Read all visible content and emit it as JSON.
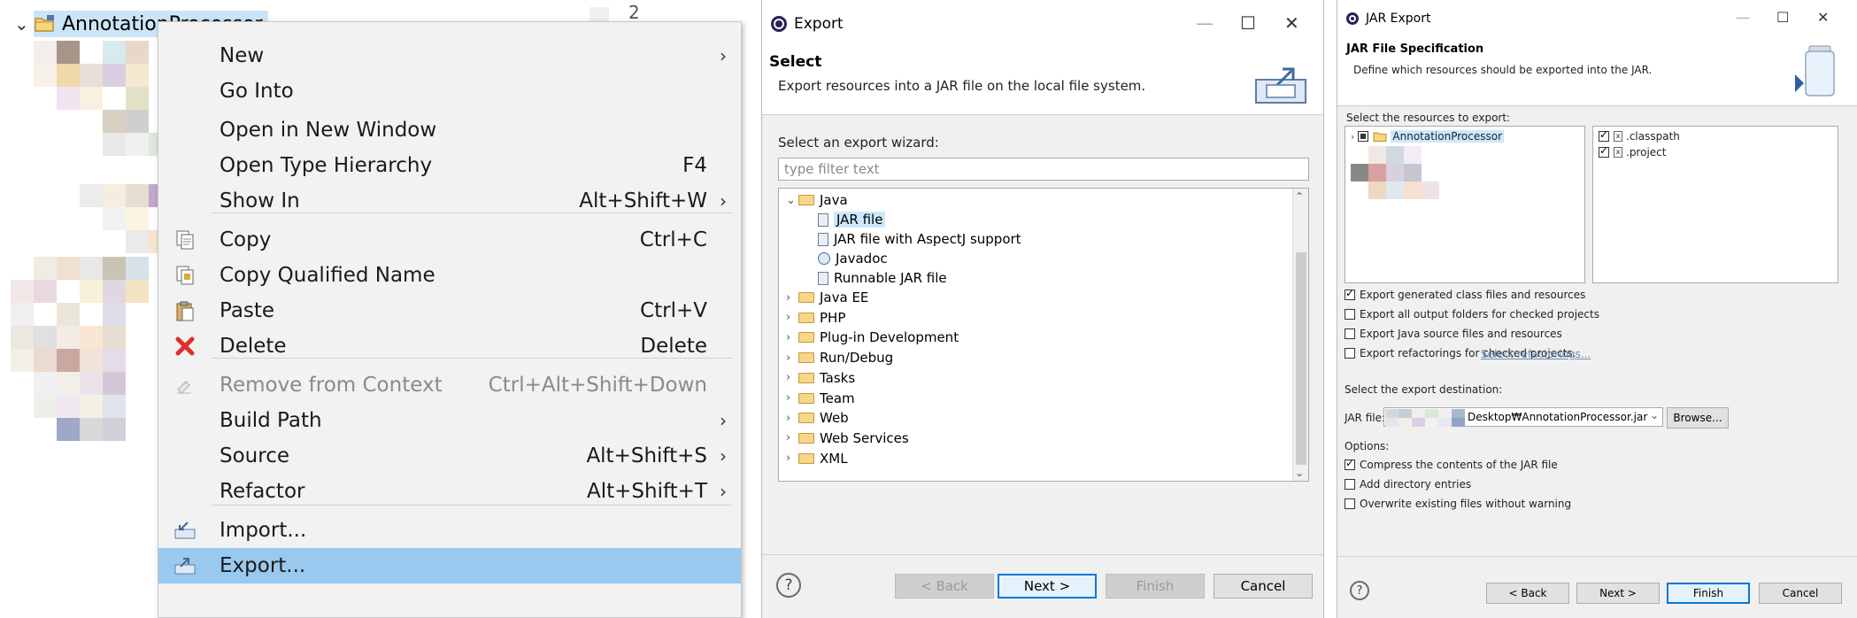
{
  "explorer": {
    "project_name": "AnnotationProcessor",
    "line_number": "2"
  },
  "context_menu": {
    "items": [
      {
        "label": "New",
        "shortcut": "",
        "submenu": true,
        "icon": ""
      },
      {
        "label": "Go Into",
        "shortcut": "",
        "submenu": false,
        "icon": ""
      },
      {
        "label": "Open in New Window",
        "shortcut": "",
        "submenu": false,
        "icon": ""
      },
      {
        "label": "Open Type Hierarchy",
        "shortcut": "F4",
        "submenu": false,
        "icon": ""
      },
      {
        "label": "Show In",
        "shortcut": "Alt+Shift+W",
        "submenu": true,
        "icon": ""
      },
      {
        "label": "Copy",
        "shortcut": "Ctrl+C",
        "submenu": false,
        "icon": "copy-icon"
      },
      {
        "label": "Copy Qualified Name",
        "shortcut": "",
        "submenu": false,
        "icon": "copy-qualified-name-icon"
      },
      {
        "label": "Paste",
        "shortcut": "Ctrl+V",
        "submenu": false,
        "icon": "paste-icon"
      },
      {
        "label": "Delete",
        "shortcut": "Delete",
        "submenu": false,
        "icon": "delete-icon"
      },
      {
        "label": "Remove from Context",
        "shortcut": "Ctrl+Alt+Shift+Down",
        "submenu": false,
        "icon": "remove-context-icon",
        "disabled": true
      },
      {
        "label": "Build Path",
        "shortcut": "",
        "submenu": true,
        "icon": ""
      },
      {
        "label": "Source",
        "shortcut": "Alt+Shift+S",
        "submenu": true,
        "icon": ""
      },
      {
        "label": "Refactor",
        "shortcut": "Alt+Shift+T",
        "submenu": true,
        "icon": ""
      },
      {
        "label": "Import...",
        "shortcut": "",
        "submenu": false,
        "icon": "import-icon"
      },
      {
        "label": "Export...",
        "shortcut": "",
        "submenu": false,
        "icon": "export-icon",
        "highlighted": true
      }
    ]
  },
  "export_dialog": {
    "title": "Export",
    "banner_title": "Select",
    "banner_desc": "Export resources into a JAR file on the local file system.",
    "wizard_label": "Select an export wizard:",
    "filter_placeholder": "type filter text",
    "tree": {
      "java": "Java",
      "java_children": [
        "JAR file",
        "JAR file with AspectJ support",
        "Javadoc",
        "Runnable JAR file"
      ],
      "folders": [
        "Java EE",
        "PHP",
        "Plug-in Development",
        "Run/Debug",
        "Tasks",
        "Team",
        "Web",
        "Web Services",
        "XML"
      ]
    },
    "buttons": {
      "back": "< Back",
      "next": "Next >",
      "finish": "Finish",
      "cancel": "Cancel"
    },
    "help": "?"
  },
  "jar_dialog": {
    "title": "JAR Export",
    "banner_title": "JAR File Specification",
    "banner_desc": "Define which resources should be exported into the JAR.",
    "resources_label": "Select the resources to export:",
    "project": "AnnotationProcessor",
    "files": [
      ".classpath",
      ".project"
    ],
    "options_a": [
      {
        "label": "Export generated class files and resources",
        "checked": true
      },
      {
        "label": "Export all output folders for checked projects",
        "checked": false
      },
      {
        "label": "Export Java source files and resources",
        "checked": false
      },
      {
        "label": "Export refactorings for checked projects.",
        "checked": false
      }
    ],
    "select_refactorings": "Select refactorings...",
    "destination_label": "Select the export destination:",
    "jar_file_label": "JAR file:",
    "jar_file_value": "Desktop₩AnnotationProcessor.jar",
    "browse": "Browse...",
    "options_label": "Options:",
    "options_b": [
      {
        "label": "Compress the contents of the JAR file",
        "checked": true
      },
      {
        "label": "Add directory entries",
        "checked": false
      },
      {
        "label": "Overwrite existing files without warning",
        "checked": false
      }
    ],
    "buttons": {
      "back": "< Back",
      "next": "Next >",
      "finish": "Finish",
      "cancel": "Cancel"
    },
    "help": "?"
  }
}
